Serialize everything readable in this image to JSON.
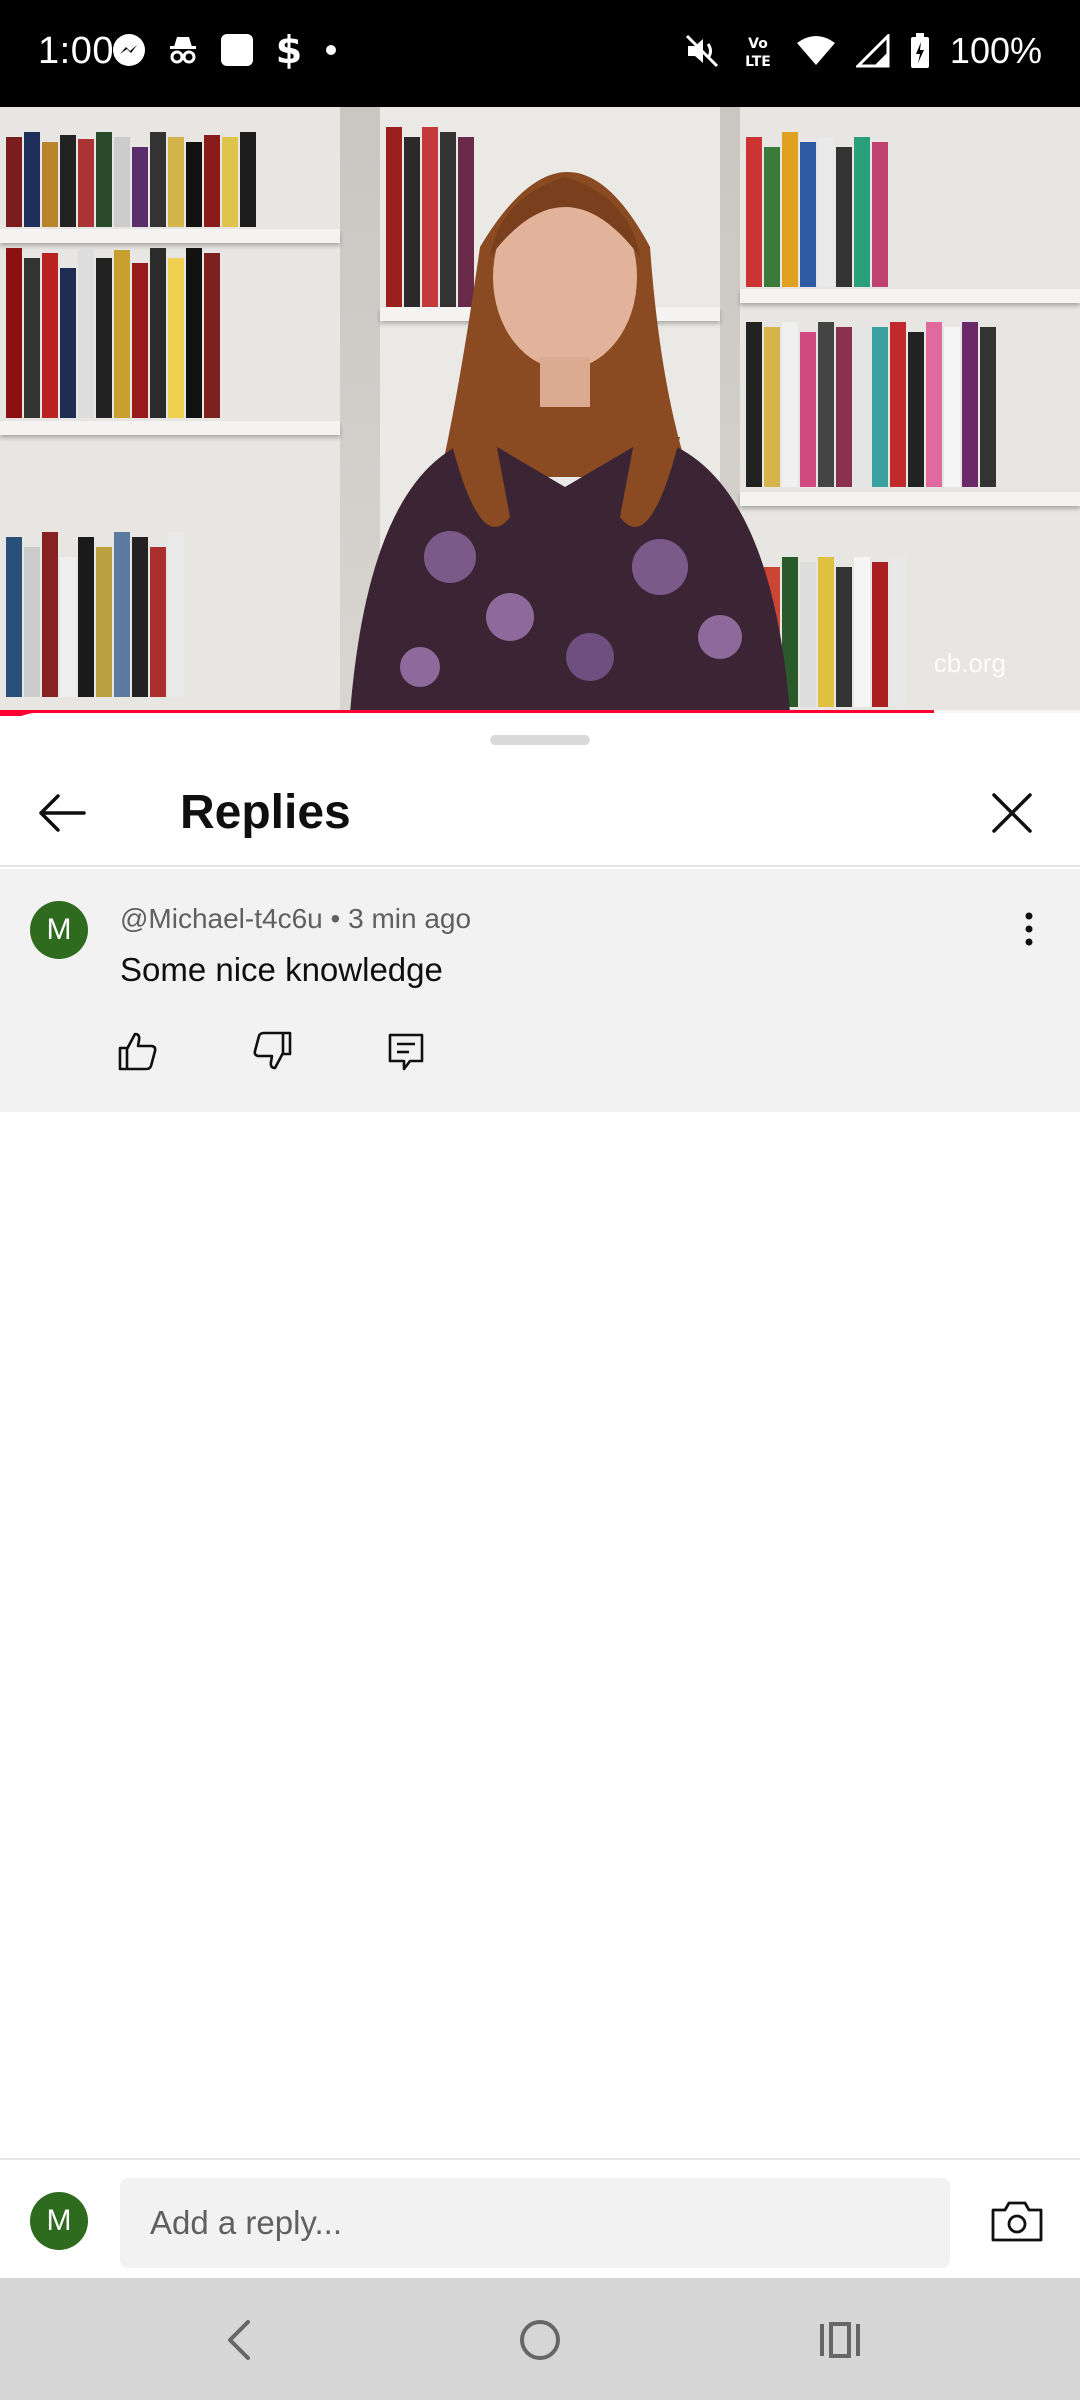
{
  "status_bar": {
    "time": "1:00",
    "battery": "100%",
    "left_icons": [
      "messenger-icon",
      "incognito-icon",
      "square-app-icon",
      "dollar-icon",
      "dot-icon"
    ],
    "right_icons": [
      "mute-icon",
      "volte-icon",
      "wifi-icon",
      "signal-icon",
      "battery-icon"
    ]
  },
  "video": {
    "watermark": "cb.org",
    "progress_fraction": 0.865
  },
  "replies_sheet": {
    "title": "Replies",
    "comment": {
      "avatar_letter": "M",
      "author": "@Michael-t4c6u",
      "separator": " • ",
      "time": "3 min ago",
      "text": "Some nice knowledge"
    },
    "reply_bar": {
      "avatar_letter": "M",
      "placeholder": "Add a reply..."
    }
  },
  "colors": {
    "accent": "#ff0033",
    "avatar": "#2e6b1f",
    "comment_bg": "#f2f2f2"
  }
}
